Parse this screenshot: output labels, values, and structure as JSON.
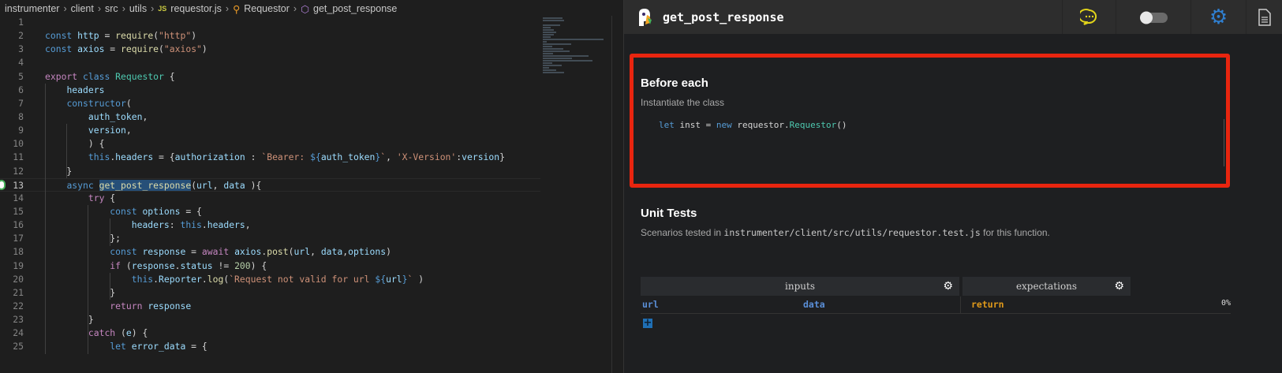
{
  "breadcrumb": {
    "items": [
      "instrumenter",
      "client",
      "src",
      "utils"
    ],
    "file": "requestor.js",
    "file_icon": "JS",
    "class_name": "Requestor",
    "method": "get_post_response"
  },
  "code": [
    [],
    [
      [
        "k",
        "const "
      ],
      [
        "v",
        "http"
      ],
      [
        "p",
        " = "
      ],
      [
        "f",
        "require"
      ],
      [
        "p",
        "("
      ],
      [
        "s",
        "\"http\""
      ],
      [
        "p",
        ")"
      ]
    ],
    [
      [
        "k",
        "const "
      ],
      [
        "v",
        "axios"
      ],
      [
        "p",
        " = "
      ],
      [
        "f",
        "require"
      ],
      [
        "p",
        "("
      ],
      [
        "s",
        "\"axios\""
      ],
      [
        "p",
        ")"
      ]
    ],
    [],
    [
      [
        "c",
        "export "
      ],
      [
        "k",
        "class "
      ],
      [
        "t",
        "Requestor"
      ],
      [
        "p",
        " {"
      ]
    ],
    [
      [
        "p",
        "    "
      ],
      [
        "v",
        "headers"
      ]
    ],
    [
      [
        "p",
        "    "
      ],
      [
        "k",
        "constructor"
      ],
      [
        "p",
        "("
      ]
    ],
    [
      [
        "p",
        "        "
      ],
      [
        "v",
        "auth_token"
      ],
      [
        "p",
        ","
      ]
    ],
    [
      [
        "p",
        "        "
      ],
      [
        "v",
        "version"
      ],
      [
        "p",
        ","
      ]
    ],
    [
      [
        "p",
        "        ) {"
      ]
    ],
    [
      [
        "p",
        "        "
      ],
      [
        "k",
        "this"
      ],
      [
        "p",
        "."
      ],
      [
        "v",
        "headers"
      ],
      [
        "p",
        " = {"
      ],
      [
        "v",
        "authorization"
      ],
      [
        "p",
        " : "
      ],
      [
        "s",
        "`Bearer: "
      ],
      [
        "k",
        "${"
      ],
      [
        "v",
        "auth_token"
      ],
      [
        "k",
        "}"
      ],
      [
        "s",
        "`"
      ],
      [
        "p",
        ", "
      ],
      [
        "s",
        "'X-Version'"
      ],
      [
        "p",
        ":"
      ],
      [
        "v",
        "version"
      ],
      [
        "p",
        "}"
      ]
    ],
    [
      [
        "p",
        "    }"
      ]
    ],
    [
      [
        "p",
        "    "
      ],
      [
        "k",
        "async "
      ],
      [
        "f hl",
        "get_post_response"
      ],
      [
        "p",
        "("
      ],
      [
        "v",
        "url"
      ],
      [
        "p",
        ", "
      ],
      [
        "v",
        "data"
      ],
      [
        "p",
        " ){"
      ]
    ],
    [
      [
        "p",
        "        "
      ],
      [
        "c",
        "try"
      ],
      [
        "p",
        " {"
      ]
    ],
    [
      [
        "p",
        "            "
      ],
      [
        "k",
        "const "
      ],
      [
        "v",
        "options"
      ],
      [
        "p",
        " = {"
      ]
    ],
    [
      [
        "p",
        "                "
      ],
      [
        "v",
        "headers"
      ],
      [
        "p",
        ": "
      ],
      [
        "k",
        "this"
      ],
      [
        "p",
        "."
      ],
      [
        "v",
        "headers"
      ],
      [
        "p",
        ","
      ]
    ],
    [
      [
        "p",
        "            };"
      ]
    ],
    [
      [
        "p",
        "            "
      ],
      [
        "k",
        "const "
      ],
      [
        "v",
        "response"
      ],
      [
        "p",
        " = "
      ],
      [
        "c",
        "await "
      ],
      [
        "v",
        "axios"
      ],
      [
        "p",
        "."
      ],
      [
        "f",
        "post"
      ],
      [
        "p",
        "("
      ],
      [
        "v",
        "url"
      ],
      [
        "p",
        ", "
      ],
      [
        "v",
        "data"
      ],
      [
        "p",
        ","
      ],
      [
        "v",
        "options"
      ],
      [
        "p",
        ")"
      ]
    ],
    [
      [
        "p",
        "            "
      ],
      [
        "c",
        "if"
      ],
      [
        "p",
        " ("
      ],
      [
        "v",
        "response"
      ],
      [
        "p",
        "."
      ],
      [
        "v",
        "status"
      ],
      [
        "p",
        " != "
      ],
      [
        "n",
        "200"
      ],
      [
        "p",
        ") {"
      ]
    ],
    [
      [
        "p",
        "                "
      ],
      [
        "k",
        "this"
      ],
      [
        "p",
        "."
      ],
      [
        "v",
        "Reporter"
      ],
      [
        "p",
        "."
      ],
      [
        "f",
        "log"
      ],
      [
        "p",
        "("
      ],
      [
        "s",
        "`Request not valid for url "
      ],
      [
        "k",
        "${"
      ],
      [
        "v",
        "url"
      ],
      [
        "k",
        "}"
      ],
      [
        "s",
        "`"
      ],
      [
        "p",
        " )"
      ]
    ],
    [
      [
        "p",
        "            }"
      ]
    ],
    [
      [
        "p",
        "            "
      ],
      [
        "c",
        "return "
      ],
      [
        "v",
        "response"
      ]
    ],
    [
      [
        "p",
        "        }"
      ]
    ],
    [
      [
        "p",
        "        "
      ],
      [
        "c",
        "catch"
      ],
      [
        "p",
        " ("
      ],
      [
        "v",
        "e"
      ],
      [
        "p",
        ") {"
      ]
    ],
    [
      [
        "p",
        "            "
      ],
      [
        "k",
        "let "
      ],
      [
        "v",
        "error_data"
      ],
      [
        "p",
        " = {"
      ]
    ]
  ],
  "panel": {
    "title": "get_post_response",
    "header_icons": [
      "comment-icon",
      "toggle-switch",
      "gear-icon",
      "document-icon"
    ],
    "toggle_on": false,
    "before_each": {
      "heading": "Before each",
      "description": "Instantiate the class",
      "code": [
        [
          "k",
          "let "
        ],
        [
          "p",
          "inst = "
        ],
        [
          "k",
          "new "
        ],
        [
          "p",
          "requestor."
        ],
        [
          "t",
          "Requestor"
        ],
        [
          "p",
          "()"
        ]
      ]
    },
    "unit_tests": {
      "heading": "Unit Tests",
      "desc_prefix": "Scenarios tested in ",
      "desc_path": "instrumenter/client/src/utils/requestor.test.js",
      "desc_suffix": " for this function.",
      "inputs_label": "inputs",
      "expectations_label": "expectations",
      "columns": [
        "url",
        "data"
      ],
      "return_label": "return",
      "coverage": "0%"
    }
  },
  "colors": {
    "highlight_border": "#e8250f",
    "accent_blue": "#1f6fb5",
    "input_col": "#5a8fd8",
    "return_col": "#e09a1a",
    "comment_icon": "#e2d41a"
  }
}
